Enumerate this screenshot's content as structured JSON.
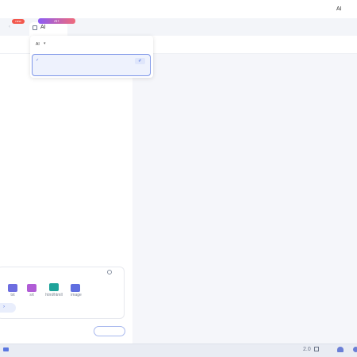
{
  "topbar": {
    "user_label": "AI"
  },
  "tabs": {
    "new_badge": "new",
    "ai_badge": "AI+",
    "ai_tab_label": "AI"
  },
  "dropdown": {
    "select_label": "AI",
    "selected_check": "✓",
    "edit_icon": "✐"
  },
  "input_card": {
    "formats": [
      "txt",
      "srt",
      "html/htmll",
      "image"
    ]
  },
  "statusbar": {
    "version": "2.0"
  },
  "colors": {
    "accent": "#4d6fe0",
    "badge_new": "#f2574c",
    "badge_ai_start": "#8b5cf6",
    "badge_ai_end": "#f06a7a"
  },
  "icons": [
    "clock-icon",
    "mail-icon",
    "grid-icon",
    "android-icon",
    "chevron-right-icon",
    "check-icon",
    "edit-icon"
  ]
}
